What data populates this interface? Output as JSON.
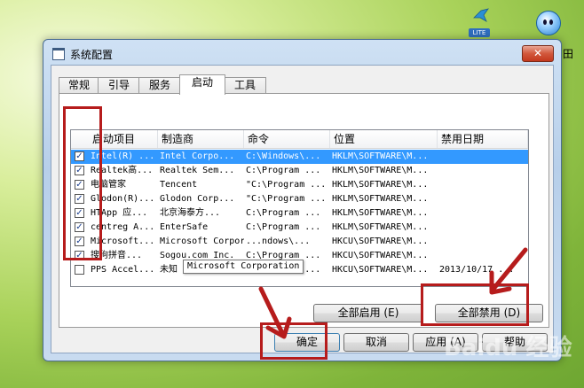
{
  "desktop": {
    "lite_badge": "LITE",
    "corner_char": "田",
    "watermark": "Baidu 经验"
  },
  "window": {
    "title": "系统配置",
    "close_label": "✕",
    "tabs": [
      {
        "label": "常规"
      },
      {
        "label": "引导"
      },
      {
        "label": "服务"
      },
      {
        "label": "启动"
      },
      {
        "label": "工具"
      }
    ],
    "active_tab": "启动",
    "columns": [
      "启动项目",
      "制造商",
      "命令",
      "位置",
      "禁用日期"
    ],
    "rows": [
      {
        "checked": "✓",
        "item": "Intel(R) ...",
        "maker": "Intel Corpo...",
        "command": "C:\\Windows\\...",
        "location": "HKLM\\SOFTWARE\\M...",
        "date": ""
      },
      {
        "checked": "✓",
        "item": "Realtek高...",
        "maker": "Realtek Sem...",
        "command": "C:\\Program ...",
        "location": "HKLM\\SOFTWARE\\M...",
        "date": ""
      },
      {
        "checked": "✓",
        "item": "电脑管家",
        "maker": "Tencent",
        "command": "\"C:\\Program ...",
        "location": "HKLM\\SOFTWARE\\M...",
        "date": ""
      },
      {
        "checked": "✓",
        "item": "Glodon(R)...",
        "maker": "Glodon Corp...",
        "command": "\"C:\\Program ...",
        "location": "HKLM\\SOFTWARE\\M...",
        "date": ""
      },
      {
        "checked": "✓",
        "item": "HTApp 应...",
        "maker": "北京海泰方...",
        "command": "C:\\Program ...",
        "location": "HKLM\\SOFTWARE\\M...",
        "date": ""
      },
      {
        "checked": "✓",
        "item": "centreg A...",
        "maker": "EnterSafe",
        "command": "C:\\Program ...",
        "location": "HKLM\\SOFTWARE\\M...",
        "date": ""
      },
      {
        "checked": "✓",
        "item": "Microsoft...",
        "maker": "Microsoft Corporation",
        "command": "...ndows\\...",
        "location": "HKCU\\SOFTWARE\\M...",
        "date": ""
      },
      {
        "checked": "✓",
        "item": "搜狗拼音...",
        "maker": "Sogou.com Inc.",
        "command": "C:\\Program ...",
        "location": "HKCU\\SOFTWARE\\M...",
        "date": ""
      },
      {
        "checked": "",
        "item": "PPS Accel...",
        "maker": "未知",
        "command": "C:\\Program ...",
        "location": "HKCU\\SOFTWARE\\M...",
        "date": "2013/10/17 ..."
      }
    ],
    "tooltip": "Microsoft Corporation",
    "buttons": {
      "enable_all": "全部启用 (E)",
      "disable_all": "全部禁用 (D)",
      "ok": "确定",
      "cancel": "取消",
      "apply": "应用 (A)",
      "help": "帮助"
    }
  },
  "colors": {
    "annotation": "#b61c1c",
    "selection": "#3399ff"
  }
}
